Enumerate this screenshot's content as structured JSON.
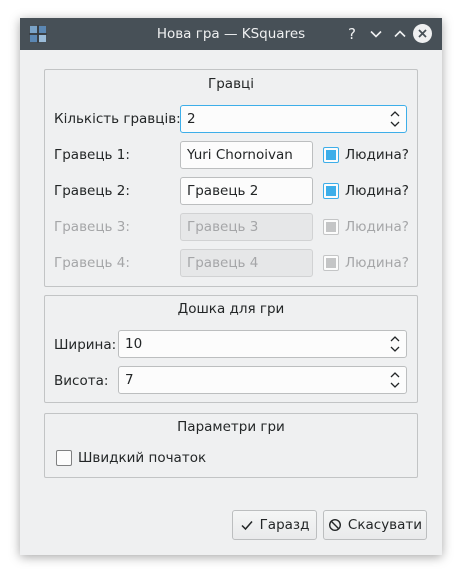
{
  "window": {
    "title": "Нова гра — KSquares",
    "help_symbol": "?",
    "app_icon": "ksquares-icon"
  },
  "players": {
    "title": "Гравці",
    "count_label": "Кількість гравців:",
    "count_value": "2",
    "rows": [
      {
        "label": "Гравець 1:",
        "name": "Yuri Chornoivan",
        "human_label": "Людина?",
        "human": true,
        "enabled": true
      },
      {
        "label": "Гравець 2:",
        "name": "Гравець 2",
        "human_label": "Людина?",
        "human": true,
        "enabled": true
      },
      {
        "label": "Гравець 3:",
        "name": "Гравець 3",
        "human_label": "Людина?",
        "human": true,
        "enabled": false
      },
      {
        "label": "Гравець 4:",
        "name": "Гравець 4",
        "human_label": "Людина?",
        "human": true,
        "enabled": false
      }
    ]
  },
  "board": {
    "title": "Дошка для гри",
    "width_label": "Ширина:",
    "width_value": "10",
    "height_label": "Висота:",
    "height_value": "7"
  },
  "params": {
    "title": "Параметри гри",
    "quick_start_label": "Швидкий початок",
    "quick_start": false
  },
  "buttons": {
    "ok_label": "Гаразд",
    "cancel_label": "Скасувати"
  },
  "colors": {
    "titlebar": "#475057",
    "accent": "#3daee9",
    "window_bg": "#eff0f1"
  }
}
